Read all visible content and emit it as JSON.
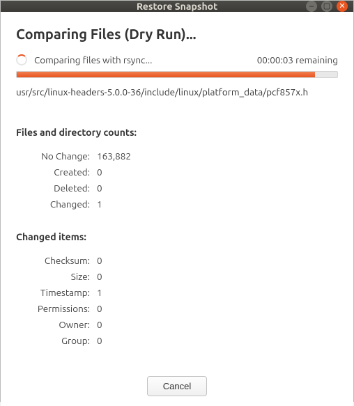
{
  "window": {
    "title": "Restore Snapshot"
  },
  "heading": "Comparing Files (Dry Run)...",
  "status": {
    "message": "Comparing files with rsync...",
    "time_remaining": "00:00:03 remaining"
  },
  "current_file": "usr/src/linux-headers-5.0.0-36/include/linux/platform_data/pcf857x.h",
  "file_counts": {
    "title": "Files and directory counts:",
    "rows": [
      {
        "label": "No Change:",
        "value": "163,882"
      },
      {
        "label": "Created:",
        "value": "0"
      },
      {
        "label": "Deleted:",
        "value": "0"
      },
      {
        "label": "Changed:",
        "value": "1"
      }
    ]
  },
  "changed_items": {
    "title": "Changed items:",
    "rows": [
      {
        "label": "Checksum:",
        "value": "0"
      },
      {
        "label": "Size:",
        "value": "0"
      },
      {
        "label": "Timestamp:",
        "value": "1"
      },
      {
        "label": "Permissions:",
        "value": "0"
      },
      {
        "label": "Owner:",
        "value": "0"
      },
      {
        "label": "Group:",
        "value": "0"
      }
    ]
  },
  "buttons": {
    "cancel": "Cancel"
  },
  "colors": {
    "accent": "#e95420"
  }
}
